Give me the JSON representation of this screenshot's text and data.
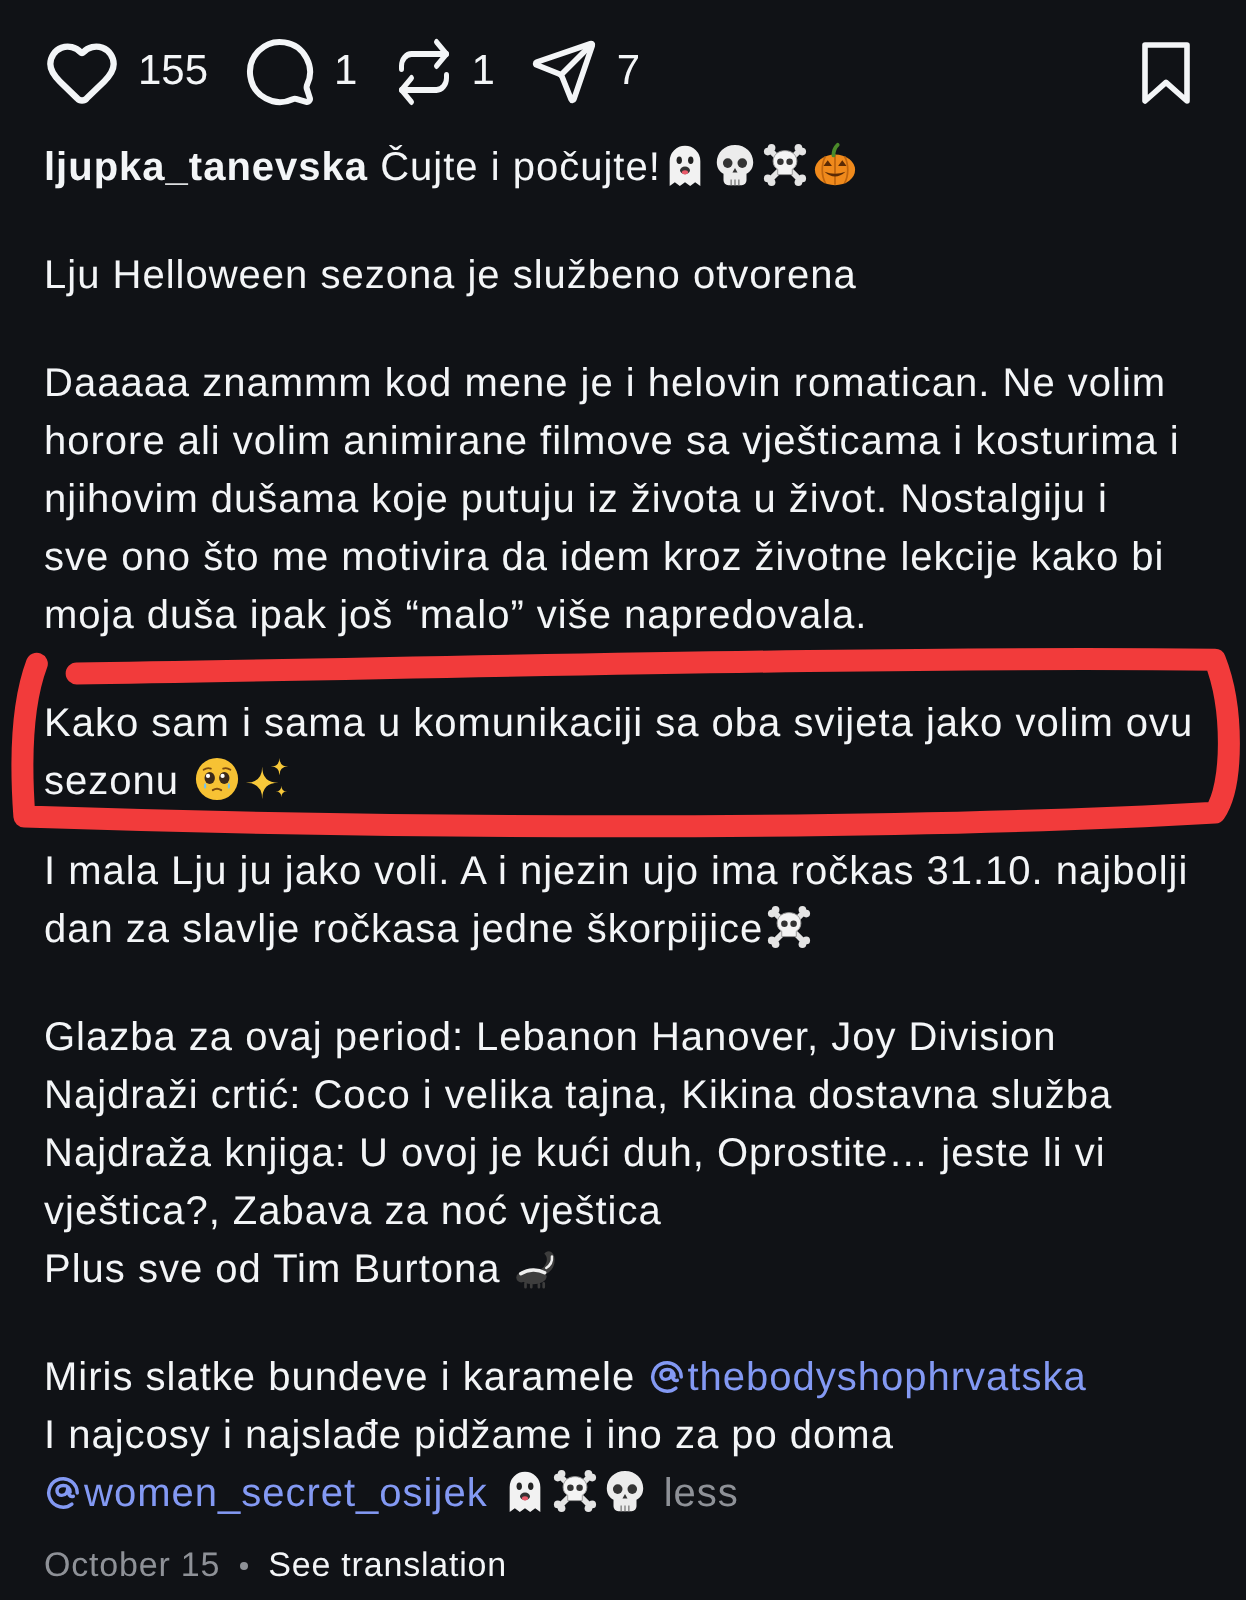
{
  "actions": [
    {
      "kind": "like",
      "count": "155"
    },
    {
      "kind": "comment",
      "count": "1"
    },
    {
      "kind": "repost",
      "count": "1"
    },
    {
      "kind": "share",
      "count": "7"
    }
  ],
  "caption": {
    "paragraphs": [
      {
        "circled": false,
        "lines": [
          [
            {
              "kind": "username",
              "text": "ljupka_tanevska"
            },
            {
              "kind": "text",
              "text": " Čujte i počujte!"
            },
            {
              "kind": "ghost"
            },
            {
              "kind": "skull"
            },
            {
              "kind": "skull-crossbones"
            },
            {
              "kind": "pumpkin"
            }
          ]
        ]
      },
      {
        "circled": false,
        "lines": [
          [
            {
              "kind": "text",
              "text": "Lju Helloween sezona je službeno otvorena"
            }
          ]
        ]
      },
      {
        "circled": false,
        "lines": [
          [
            {
              "kind": "text",
              "text": "Daaaaa znammm kod mene je i helovin romatican. Ne volim"
            }
          ],
          [
            {
              "kind": "text",
              "text": "horore ali volim animirane filmove sa vješticama i kosturima i"
            }
          ],
          [
            {
              "kind": "text",
              "text": "njihovim dušama koje putuju iz života u život. Nostalgiju i"
            }
          ],
          [
            {
              "kind": "text",
              "text": "sve ono što me motivira da idem kroz životne lekcije kako bi"
            }
          ],
          [
            {
              "kind": "text",
              "text": "moja duša ipak još “malo” više napredovala."
            }
          ]
        ]
      },
      {
        "circled": true,
        "lines": [
          [
            {
              "kind": "text",
              "text": "Kako sam i sama u komunikaciji sa oba svijeta jako volim ovu"
            }
          ],
          [
            {
              "kind": "text",
              "text": "sezonu "
            },
            {
              "kind": "pleading-face"
            },
            {
              "kind": "sparkles"
            }
          ]
        ]
      },
      {
        "circled": false,
        "lines": [
          [
            {
              "kind": "text",
              "text": "I mala Lju ju jako voli. A i njezin ujo ima ročkas 31.10. najbolji"
            }
          ],
          [
            {
              "kind": "text",
              "text": "dan za slavlje ročkasa jedne škorpijice"
            },
            {
              "kind": "skull-crossbones"
            }
          ]
        ]
      },
      {
        "circled": false,
        "lines": [
          [
            {
              "kind": "text",
              "text": "Glazba za ovaj period: Lebanon Hanover, Joy Division"
            }
          ],
          [
            {
              "kind": "text",
              "text": "Najdraži crtić: Coco i velika tajna, Kikina dostavna služba"
            }
          ],
          [
            {
              "kind": "text",
              "text": "Najdraža knjiga: U ovoj je kući duh, Oprostite… jeste li vi"
            }
          ],
          [
            {
              "kind": "text",
              "text": "vještica?, Zabava za noć vještica"
            }
          ],
          [
            {
              "kind": "text",
              "text": "Plus sve od Tim Burtona "
            },
            {
              "kind": "skunk"
            }
          ]
        ]
      },
      {
        "circled": false,
        "lines": [
          [
            {
              "kind": "text",
              "text": "Miris slatke bundeve i karamele "
            },
            {
              "kind": "mention",
              "text": "thebodyshophrvatska"
            }
          ],
          [
            {
              "kind": "text",
              "text": "I najcosy i najslađe pidžame i ino za po doma"
            }
          ],
          [
            {
              "kind": "mention",
              "text": "women_secret_osijek"
            },
            {
              "kind": "ghost"
            },
            {
              "kind": "skull-crossbones"
            },
            {
              "kind": "skull"
            },
            {
              "kind": "less",
              "text": "less"
            }
          ]
        ]
      }
    ]
  },
  "footer": {
    "date": "October 15",
    "translation": "See translation"
  }
}
